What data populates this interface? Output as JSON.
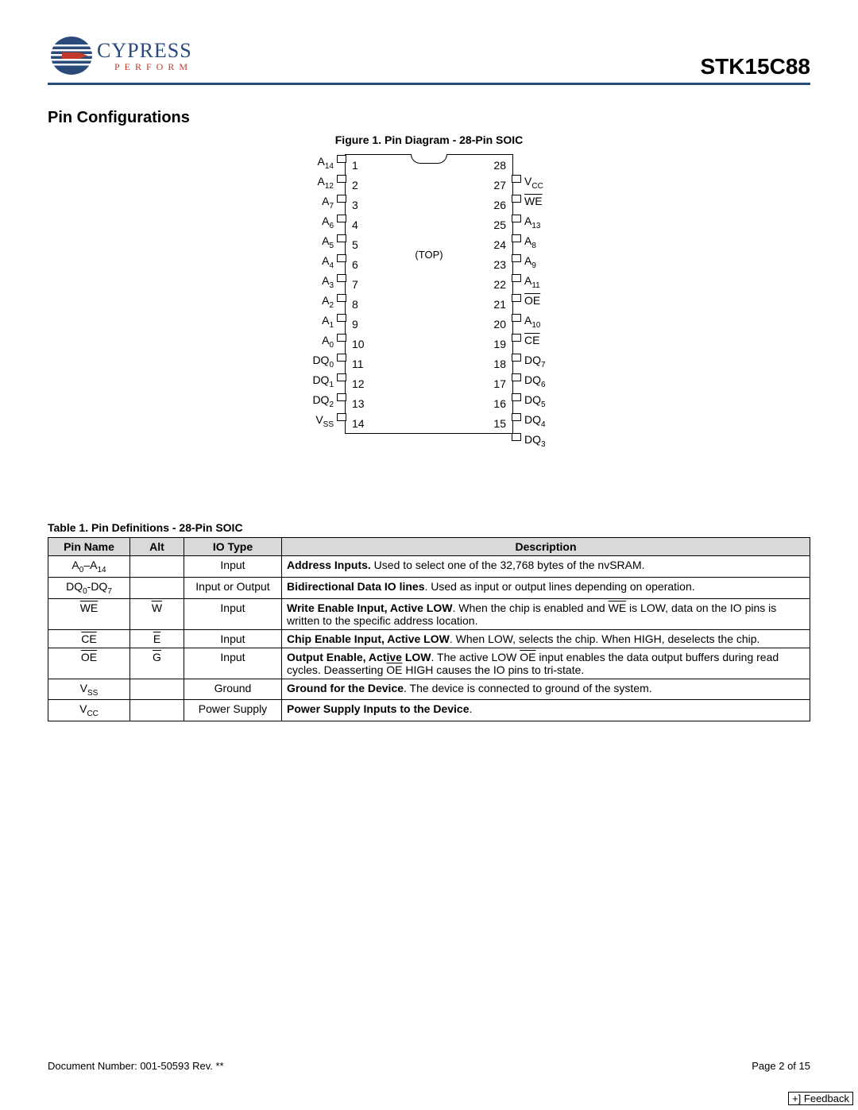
{
  "header": {
    "brand": "CYPRESS",
    "tagline": "PERFORM",
    "part": "STK15C88"
  },
  "section_title": "Pin Configurations",
  "figure_title": "Figure 1.  Pin Diagram - 28-Pin SOIC",
  "chip_top": "(TOP)",
  "pins": {
    "left": [
      {
        "num": "1",
        "lab": "A",
        "sub": "14"
      },
      {
        "num": "2",
        "lab": "A",
        "sub": "12"
      },
      {
        "num": "3",
        "lab": "A",
        "sub": "7"
      },
      {
        "num": "4",
        "lab": "A",
        "sub": "6"
      },
      {
        "num": "5",
        "lab": "A",
        "sub": "5"
      },
      {
        "num": "6",
        "lab": "A",
        "sub": "4"
      },
      {
        "num": "7",
        "lab": "A",
        "sub": "3"
      },
      {
        "num": "8",
        "lab": "A",
        "sub": "2"
      },
      {
        "num": "9",
        "lab": "A",
        "sub": "1"
      },
      {
        "num": "10",
        "lab": "A",
        "sub": "0"
      },
      {
        "num": "11",
        "lab": "DQ",
        "sub": "0"
      },
      {
        "num": "12",
        "lab": "DQ",
        "sub": "1"
      },
      {
        "num": "13",
        "lab": "DQ",
        "sub": "2"
      },
      {
        "num": "14",
        "lab": "V",
        "sub": "SS"
      }
    ],
    "right": [
      {
        "num": "28",
        "lab": "V",
        "sub": "CC"
      },
      {
        "num": "27",
        "lab": "WE",
        "ov": true
      },
      {
        "num": "26",
        "lab": "A",
        "sub": "13"
      },
      {
        "num": "25",
        "lab": "A",
        "sub": "8"
      },
      {
        "num": "24",
        "lab": "A",
        "sub": "9"
      },
      {
        "num": "23",
        "lab": "A",
        "sub": "11"
      },
      {
        "num": "22",
        "lab": "OE",
        "ov": true
      },
      {
        "num": "21",
        "lab": "A",
        "sub": "10"
      },
      {
        "num": "20",
        "lab": "CE",
        "ov": true
      },
      {
        "num": "19",
        "lab": "DQ",
        "sub": "7"
      },
      {
        "num": "18",
        "lab": "DQ",
        "sub": "6"
      },
      {
        "num": "17",
        "lab": "DQ",
        "sub": "5"
      },
      {
        "num": "16",
        "lab": "DQ",
        "sub": "4"
      },
      {
        "num": "15",
        "lab": "DQ",
        "sub": "3"
      }
    ]
  },
  "table_title": "Table 1.  Pin Definitions - 28-Pin SOIC",
  "table": {
    "headers": [
      "Pin Name",
      "Alt",
      "IO Type",
      "Description"
    ],
    "rows": [
      {
        "name_html": "A<sub>0</sub>–A<sub>14</sub>",
        "alt_html": "",
        "io": "Input",
        "desc_html": "<b>Address Inputs.</b> Used to select one of the 32,768 bytes of the nvSRAM."
      },
      {
        "name_html": "DQ<sub>0</sub>-DQ<sub>7</sub>",
        "alt_html": "",
        "io": "Input or Output",
        "desc_html": "<b>Bidirectional Data IO lines</b>. Used as input or output lines depending on operation."
      },
      {
        "name_html": "<span class='ov'>WE</span>",
        "alt_html": "<span class='ov'>W</span>",
        "io": "Input",
        "desc_html": "<b>Write Enable Input, Active LOW</b>. When the chip is enabled and <span class='ov'>WE</span> is LOW, data on the IO pins is written to the specific address location."
      },
      {
        "name_html": "<span class='ov'>CE</span>",
        "alt_html": "<span class='ov'>E</span>",
        "io": "Input",
        "desc_html": "<b>Chip Enable Input, Active LOW</b>. When LOW, selects the chip. When HIGH, deselects the chip."
      },
      {
        "name_html": "<span class='ov'>OE</span>",
        "alt_html": "<span class='ov'>G</span>",
        "io": "Input",
        "desc_html": "<b>Output Enable, Active LOW</b>. The active LOW <span class='ov'>OE</span> input enables the data output buffers during read cycles. Deasserting <span class='ov'>OE</span> HIGH causes the IO pins to tri-state."
      },
      {
        "name_html": "V<sub>SS</sub>",
        "alt_html": "",
        "io": "Ground",
        "desc_html": "<b>Ground for the Device</b>. The device is connected to ground of the system."
      },
      {
        "name_html": "V<sub>CC</sub>",
        "alt_html": "",
        "io": "Power Supply",
        "desc_html": "<b>Power Supply Inputs to the Device</b>."
      }
    ]
  },
  "footer": {
    "docnum": "Document Number: 001-50593 Rev. **",
    "page": "Page 2 of 15",
    "feedback": "+] Feedback"
  }
}
